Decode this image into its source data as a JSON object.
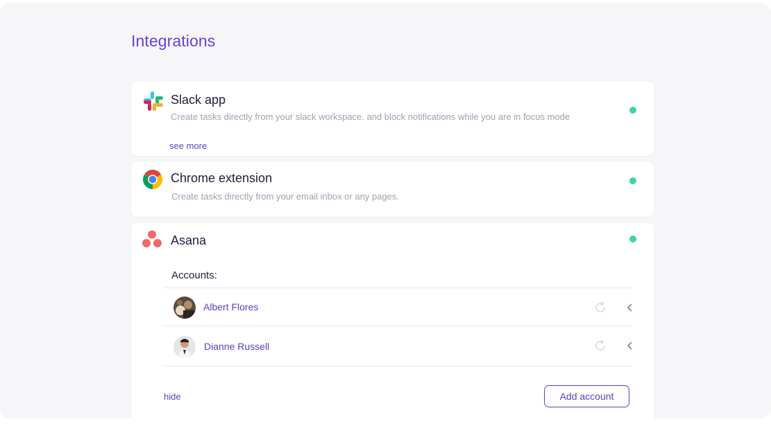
{
  "page": {
    "title": "Integrations"
  },
  "colors": {
    "accent": "#5b3fc4",
    "title": "#6a3fd6",
    "status_active": "#3dd6a3",
    "background": "#f6f6f9"
  },
  "integrations": {
    "slack": {
      "icon": "slack-logo-icon",
      "title": "Slack app",
      "description": "Create tasks directly from your slack workspace. and block notifications while you are in focus mode",
      "link": "see more",
      "status": "active"
    },
    "chrome": {
      "icon": "chrome-logo-icon",
      "title": "Chrome extension",
      "description": "Create tasks directly from your email inbox or any pages.",
      "status": "active"
    },
    "asana": {
      "icon": "asana-logo-icon",
      "title": "Asana",
      "status": "active",
      "accounts_label": "Accounts:",
      "accounts": [
        {
          "name": "Albert Flores",
          "avatar": "avatar-albert"
        },
        {
          "name": "Dianne Russell",
          "avatar": "avatar-dianne"
        }
      ],
      "hide_label": "hide",
      "add_account_label": "Add account"
    }
  }
}
